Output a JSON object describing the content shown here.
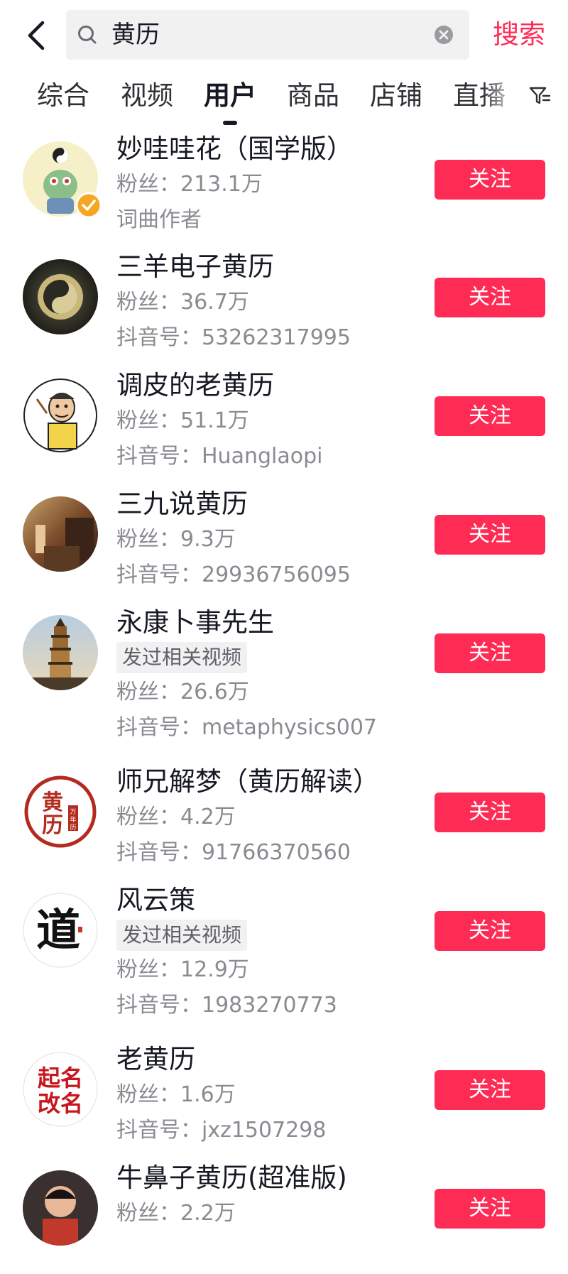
{
  "header": {
    "query": "黄历",
    "search_label": "搜索"
  },
  "tabs": [
    {
      "label": "综合"
    },
    {
      "label": "视频"
    },
    {
      "label": "用户",
      "active": true
    },
    {
      "label": "商品"
    },
    {
      "label": "店铺"
    },
    {
      "label": "直播"
    }
  ],
  "users": [
    {
      "name": "妙哇哇花（国学版）",
      "fans": "粉丝：213.1万",
      "desc": "词曲作者",
      "verified": true,
      "follow": "关注"
    },
    {
      "name": "三羊电子黄历",
      "fans": "粉丝：36.7万",
      "desc": "抖音号：53262317995",
      "follow": "关注"
    },
    {
      "name": "调皮的老黄历",
      "fans": "粉丝：51.1万",
      "desc": "抖音号：Huanglaopi",
      "follow": "关注"
    },
    {
      "name": "三九说黄历",
      "fans": "粉丝：9.3万",
      "desc": "抖音号：29936756095",
      "follow": "关注"
    },
    {
      "name": "永康卜事先生",
      "tag": "发过相关视频",
      "fans": "粉丝：26.6万",
      "desc": "抖音号：metaphysics007",
      "follow": "关注"
    },
    {
      "name": "师兄解梦（黄历解读）",
      "fans": "粉丝：4.2万",
      "desc": "抖音号：91766370560",
      "follow": "关注",
      "avatar_text": "黄历",
      "avatar_small_text": "万年历"
    },
    {
      "name": "风云策",
      "tag": "发过相关视频",
      "fans": "粉丝：12.9万",
      "desc": "抖音号：1983270773",
      "follow": "关注",
      "avatar_text": "道"
    },
    {
      "name": "老黄历",
      "fans": "粉丝：1.6万",
      "desc": "抖音号：jxz1507298",
      "follow": "关注",
      "avatar_text": "起名改名"
    },
    {
      "name": "牛鼻子黄历(超准版)",
      "fans": "粉丝：2.2万",
      "desc": "",
      "follow": "关注"
    }
  ],
  "colors": {
    "accent": "#fe2c55",
    "text_primary": "#161823",
    "text_secondary": "#8a8b91",
    "search_bg": "#f1f1f2",
    "verified": "#f5a623"
  }
}
